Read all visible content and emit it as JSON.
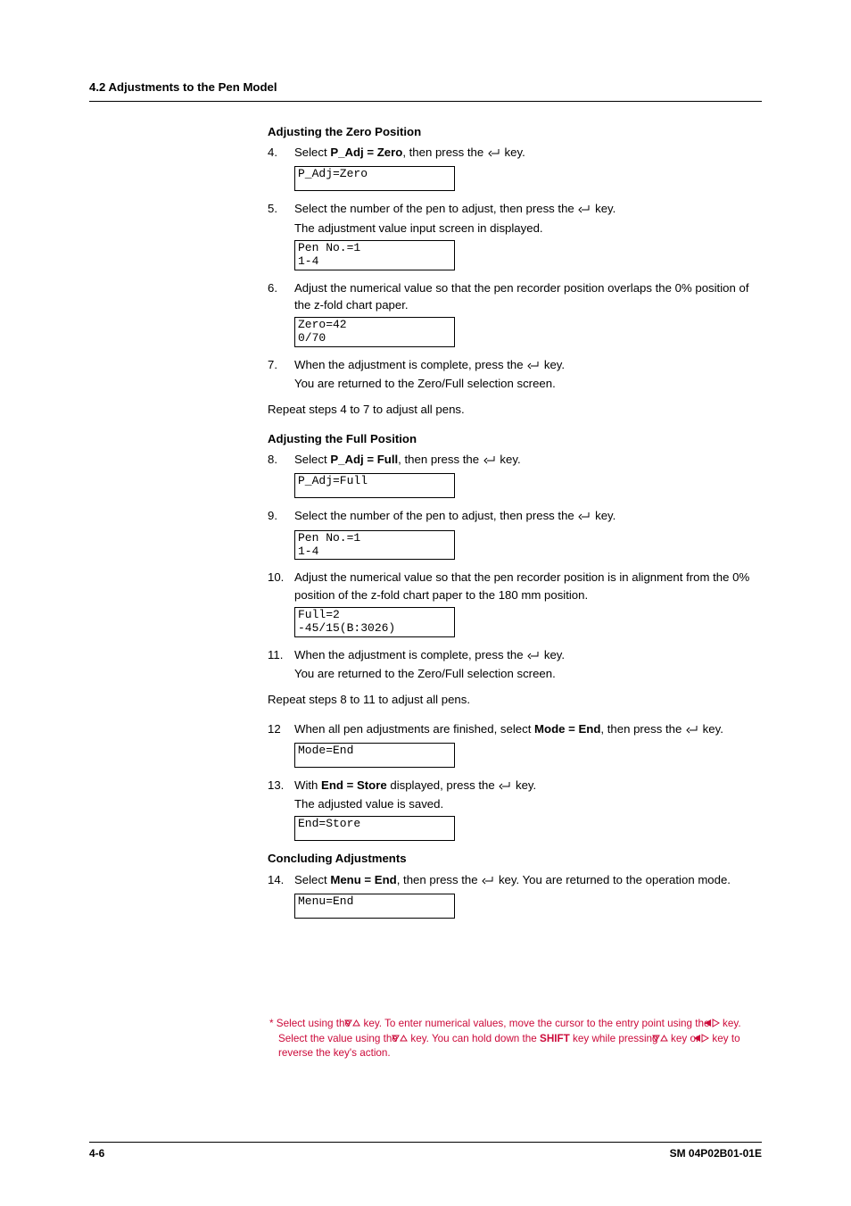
{
  "header": {
    "section": "4.2  Adjustments to the Pen Model"
  },
  "zero": {
    "heading": "Adjusting the Zero Position",
    "s4": {
      "num": "4.",
      "text_a": "Select ",
      "bold": "P_Adj = Zero",
      "text_b": ", then press the ",
      "text_c": " key.",
      "lcd1": "P_Adj=Zero",
      "lcd2": ""
    },
    "s5": {
      "num": "5.",
      "text_a": "Select the number of the pen to adjust, then press the ",
      "text_c": " key.",
      "line2": "The adjustment value input screen in displayed.",
      "lcd1": "Pen No.=1",
      "lcd2": "1-4"
    },
    "s6": {
      "num": "6.",
      "line1": "Adjust the numerical value so that the pen recorder position overlaps the 0% position of the z-fold chart paper.",
      "lcd1": "Zero=42",
      "lcd2": "0/70"
    },
    "s7": {
      "num": "7.",
      "text_a": "When the adjustment is complete, press the ",
      "text_c": " key.",
      "line2": "You are returned to the Zero/Full selection screen."
    },
    "repeat": "Repeat steps 4 to 7 to adjust all pens."
  },
  "full": {
    "heading": "Adjusting the Full Position",
    "s8": {
      "num": "8.",
      "text_a": "Select ",
      "bold": "P_Adj = Full",
      "text_b": ", then press the ",
      "text_c": " key.",
      "lcd1": "P_Adj=Full",
      "lcd2": ""
    },
    "s9": {
      "num": "9.",
      "text_a": "Select the number of the pen to adjust, then press the ",
      "text_c": " key.",
      "lcd1": "Pen No.=1",
      "lcd2": "1-4"
    },
    "s10": {
      "num": "10.",
      "line1": "Adjust the numerical value so that the pen recorder position is in alignment from the 0% position of the z-fold chart paper to the 180 mm position.",
      "lcd1": "Full=2",
      "lcd2": "-45/15(B:3026)"
    },
    "s11": {
      "num": "11.",
      "text_a": "When the adjustment is complete, press the ",
      "text_c": " key.",
      "line2": "You are returned to the Zero/Full selection screen."
    },
    "repeat": "Repeat steps 8 to 11 to adjust all pens.",
    "s12": {
      "num": "12",
      "text_a": "When all pen adjustments are finished, select ",
      "bold": "Mode = End",
      "text_b": ", then press the ",
      "text_c": " key.",
      "lcd1": "Mode=End",
      "lcd2": ""
    },
    "s13": {
      "num": "13.",
      "text_a": "With ",
      "bold": "End = Store",
      "text_b": " displayed, press the ",
      "text_c": " key.",
      "line2": "The adjusted value is saved.",
      "lcd1": "End=Store",
      "lcd2": ""
    }
  },
  "conclude": {
    "heading": "Concluding Adjustments",
    "s14": {
      "num": "14.",
      "text_a": "Select ",
      "bold": "Menu = End",
      "text_b": ", then press the ",
      "text_c": " key. You are returned to the operation mode.",
      "lcd1": "Menu=End",
      "lcd2": ""
    }
  },
  "footnote": {
    "star": "*",
    "t1": " Select using the ",
    "t2": " key. To enter numerical values, move the cursor to the entry point using the ",
    "t3": " key. Select the value using the ",
    "t4": " key. You can hold down the ",
    "shift": "SHIFT",
    "t5": " key while pressing ",
    "t6": " key or ",
    "t7": " key to reverse the key's action."
  },
  "footer": {
    "page": "4-6",
    "code": "SM 04P02B01-01E"
  }
}
